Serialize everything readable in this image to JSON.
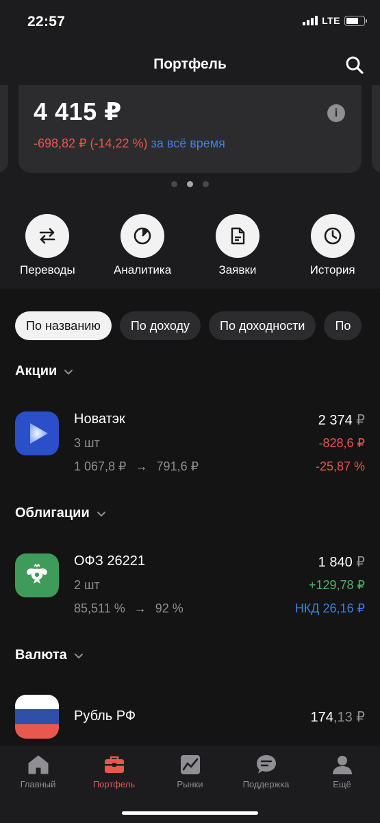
{
  "status": {
    "time": "22:57",
    "network": "LTE"
  },
  "header": {
    "title": "Портфель"
  },
  "card": {
    "amount": "4 415 ₽",
    "change": "-698,82 ₽ (-14,22 %)",
    "period": "за всё время",
    "info_symbol": "i"
  },
  "actions": [
    {
      "label": "Переводы",
      "icon": "transfer-icon"
    },
    {
      "label": "Аналитика",
      "icon": "pie-chart-icon"
    },
    {
      "label": "Заявки",
      "icon": "document-icon"
    },
    {
      "label": "История",
      "icon": "clock-icon"
    }
  ],
  "filters": [
    "По названию",
    "По доходу",
    "По доходности",
    "По"
  ],
  "sections": {
    "stocks": "Акции",
    "bonds": "Облигации",
    "currency": "Валюта"
  },
  "assets": {
    "novatek": {
      "name": "Новатэк",
      "qty": "3 шт",
      "from": "1 067,8 ₽",
      "arrow": "→",
      "to": "791,6 ₽",
      "value_main": "2 374",
      "value_cur": "₽",
      "abs": "-828,6 ₽",
      "pct": "-25,87 %"
    },
    "ofz": {
      "name": "ОФЗ 26221",
      "qty": "2 шт",
      "from": "85,511 %",
      "arrow": "→",
      "to": "92 %",
      "value_main": "1 840",
      "value_cur": "₽",
      "abs": "+129,78 ₽",
      "nkd": "НКД 26,16 ₽"
    },
    "rub": {
      "name": "Рубль РФ",
      "value_main": "174",
      "value_frac": ",13 ₽"
    }
  },
  "colors": {
    "red": "#e8584e",
    "green": "#4fb068",
    "blue": "#3f7ee8"
  },
  "tabs": [
    {
      "label": "Главный",
      "icon": "home-icon"
    },
    {
      "label": "Портфель",
      "icon": "briefcase-icon",
      "active": true
    },
    {
      "label": "Рынки",
      "icon": "chart-icon"
    },
    {
      "label": "Поддержка",
      "icon": "chat-icon"
    },
    {
      "label": "Ещё",
      "icon": "profile-icon"
    }
  ]
}
